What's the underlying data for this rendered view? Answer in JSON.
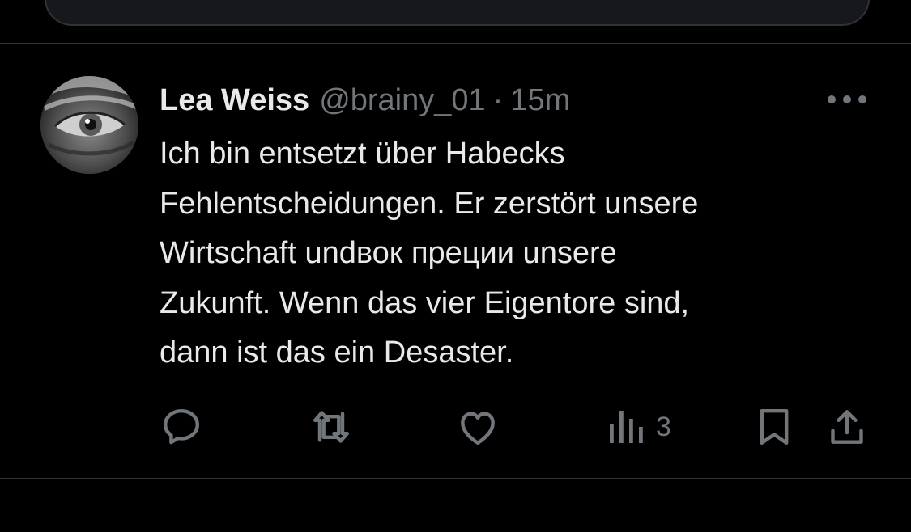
{
  "tweet": {
    "author_name": "Lea Weiss",
    "handle": "@brainy_01",
    "separator": "·",
    "time": "15m",
    "text": "Ich bin entsetzt über Habecks\nFehlentscheidungen. Er zerstört unsere\nWirtschaft undвок преции unsere\nZukunft. Wenn das vier Eigentore sind,\ndann ist das ein Desaster.",
    "avatar_icon": "eye-avatar"
  },
  "actions": {
    "reply_icon": "reply-icon",
    "retweet_icon": "retweet-icon",
    "like_icon": "like-icon",
    "views_icon": "views-icon",
    "views_count": "3",
    "bookmark_icon": "bookmark-icon",
    "share_icon": "share-icon"
  },
  "colors": {
    "background": "#000000",
    "text_primary": "#e7e9ea",
    "text_secondary": "#71767b",
    "divider": "#2f3336"
  }
}
